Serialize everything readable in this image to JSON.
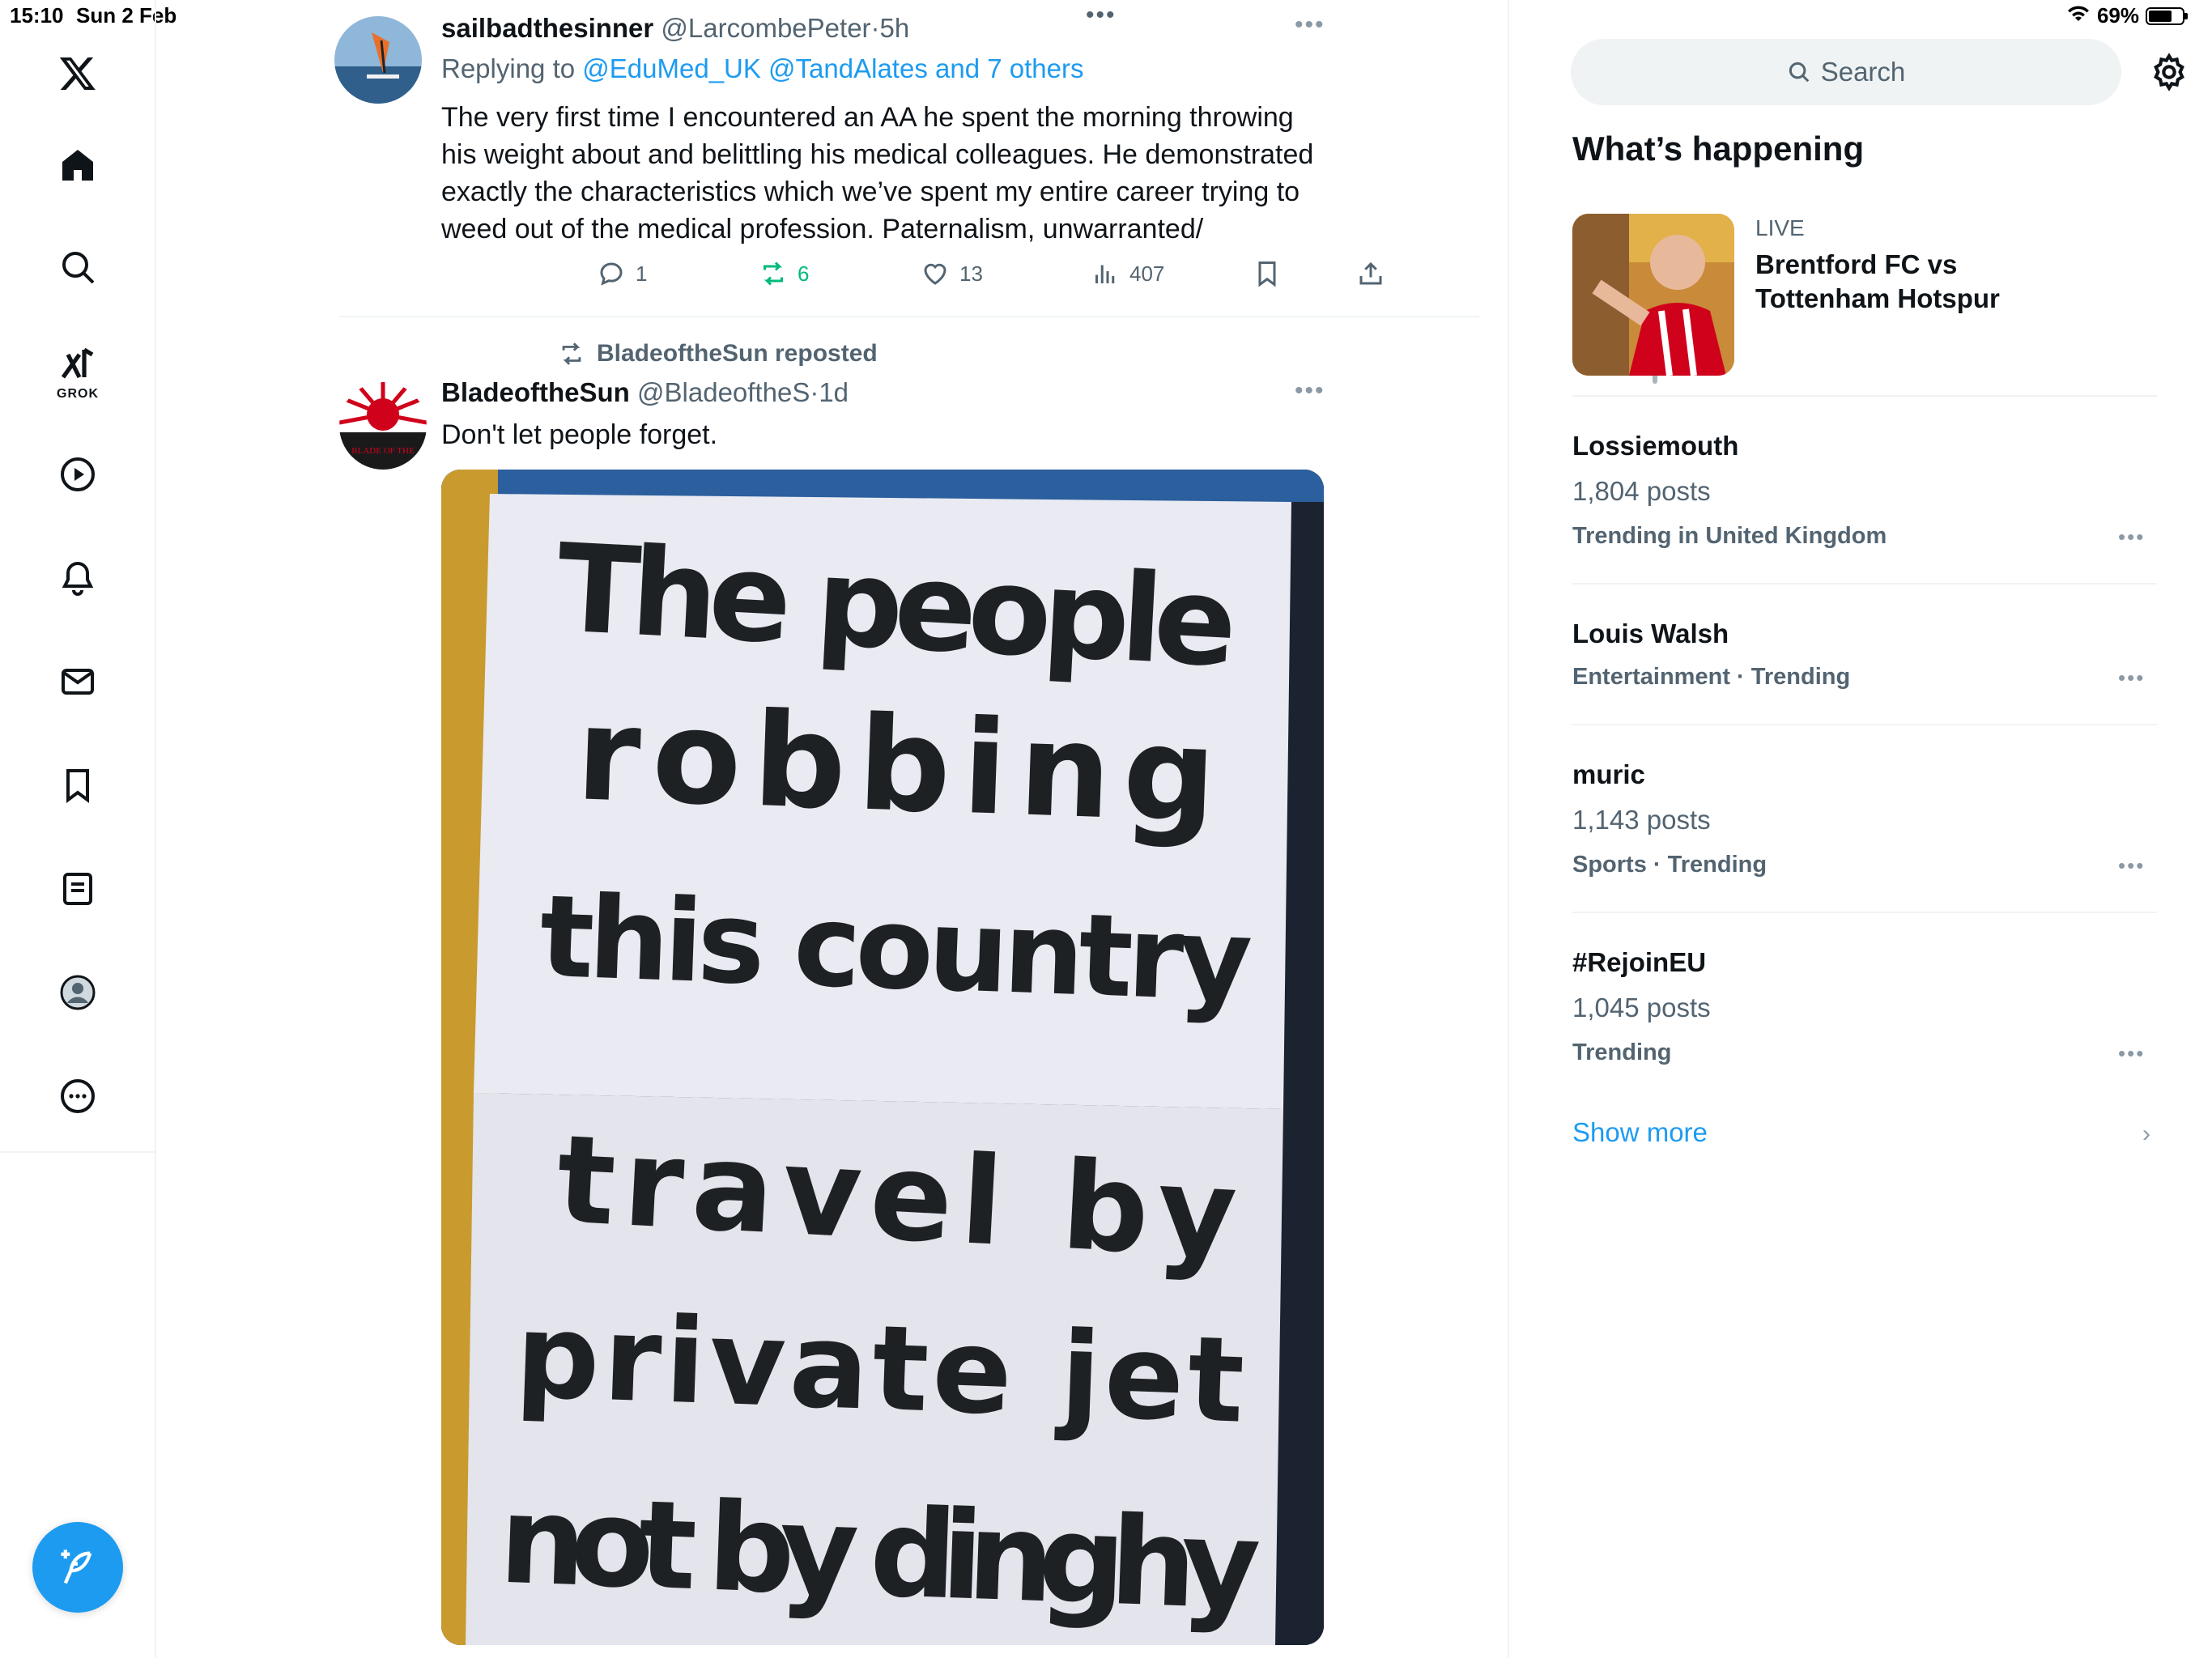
{
  "status_bar": {
    "time": "15:10",
    "date": "Sun 2 Feb",
    "battery": "69%"
  },
  "nav": {
    "items": [
      "x-logo",
      "home",
      "search",
      "grok",
      "video",
      "notifications",
      "messages",
      "bookmarks",
      "lists",
      "profile",
      "more"
    ],
    "grok_label": "GROK"
  },
  "tweet1": {
    "name": "sailbadthesinner",
    "handle": "@LarcombePeter",
    "time": "5h",
    "replying_prefix": "Replying to",
    "replying_to": "@EduMed_UK @TandAlates and 7 others",
    "text_lines": [
      "The very first time I encountered an AA he spent the morning throwing",
      "his weight about and belittling his medical colleagues. He demonstrated",
      "exactly the characteristics which we’ve spent my entire career trying to",
      "weed out of the medical profession. Paternalism, unwarranted/"
    ],
    "replies": "1",
    "reposts": "6",
    "likes": "13",
    "views": "407"
  },
  "tweet2": {
    "reposted_by": "BladeoftheSun reposted",
    "name": "BladeoftheSun",
    "handle": "@BladeoftheS",
    "time": "1d",
    "text": "Don't let people forget.",
    "avatar_text": "BLADE OF THE",
    "sign_lines": [
      "The people",
      "robbing",
      "this country",
      "travel by",
      "private jet",
      "not by dinghy"
    ]
  },
  "sidebar": {
    "search_placeholder": "Search",
    "whats_happening": "What’s happening",
    "live": {
      "label": "LIVE",
      "title_line1": "Brentford FC vs",
      "title_line2": "Tottenham Hotspur"
    },
    "trends": [
      {
        "title": "Lossiemouth",
        "posts": "1,804 posts",
        "meta": "Trending in United Kingdom"
      },
      {
        "title": "Louis Walsh",
        "posts": "",
        "meta": "Entertainment · Trending"
      },
      {
        "title": "muric",
        "posts": "1,143 posts",
        "meta": "Sports · Trending"
      },
      {
        "title": "#RejoinEU",
        "posts": "1,045 posts",
        "meta": "Trending"
      }
    ],
    "show_more": "Show more"
  }
}
